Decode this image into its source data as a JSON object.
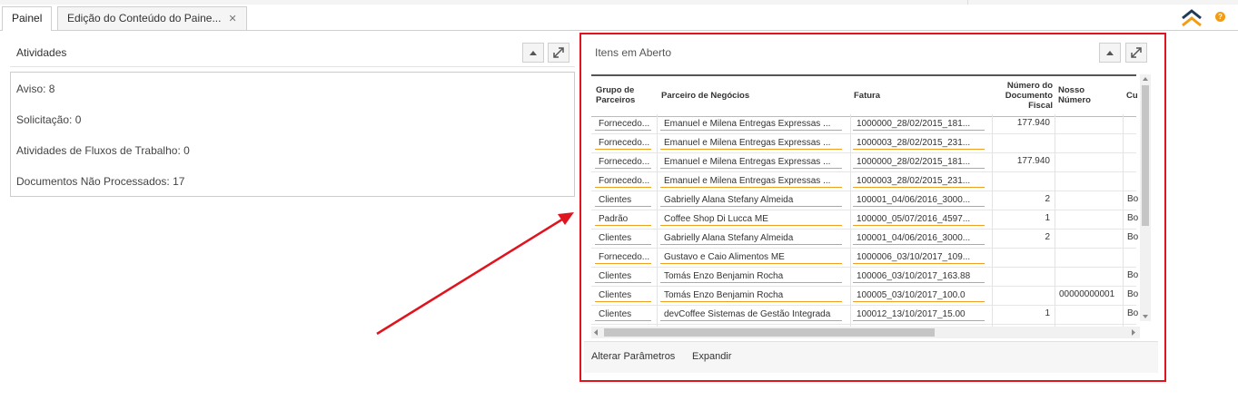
{
  "tabs": [
    {
      "label": "Painel",
      "active": true
    },
    {
      "label": "Edição do Conteúdo do Paine...",
      "active": false,
      "closable": true
    }
  ],
  "icons": {
    "tab_close": "✕",
    "help": "?",
    "collapse_up": "chevron-double-up-icon"
  },
  "colors": {
    "accent_orange": "#f39c12",
    "highlight_red": "#e0141e",
    "chevron_blue": "#1f3b5a"
  },
  "activities": {
    "title": "Atividades",
    "lines": [
      "Aviso: 8",
      "Solicitação: 0",
      "Atividades de Fluxos de Trabalho: 0",
      "Documentos Não Processados: 17"
    ]
  },
  "open_items": {
    "title": "Itens em Aberto",
    "columns": [
      "Grupo de Parceiros",
      "Parceiro de Negócios",
      "Fatura",
      "Número do Documento Fiscal",
      "Nosso Número",
      "Cu"
    ],
    "rows": [
      [
        "Fornecedo...",
        "Emanuel e Milena Entregas Expressas ...",
        "1000000_28/02/2015_181...",
        "177.940",
        "",
        ""
      ],
      [
        "Fornecedo...",
        "Emanuel e Milena Entregas Expressas ...",
        "1000003_28/02/2015_231...",
        "",
        "",
        ""
      ],
      [
        "Fornecedo...",
        "Emanuel e Milena Entregas Expressas ...",
        "1000000_28/02/2015_181...",
        "177.940",
        "",
        ""
      ],
      [
        "Fornecedo...",
        "Emanuel e Milena Entregas Expressas ...",
        "1000003_28/02/2015_231...",
        "",
        "",
        ""
      ],
      [
        "Clientes",
        "Gabrielly Alana Stefany Almeida",
        "100001_04/06/2016_3000...",
        "2",
        "",
        "Bo"
      ],
      [
        "Padrão",
        "Coffee Shop Di Lucca ME",
        "100000_05/07/2016_4597...",
        "1",
        "",
        "Bo"
      ],
      [
        "Clientes",
        "Gabrielly Alana Stefany Almeida",
        "100001_04/06/2016_3000...",
        "2",
        "",
        "Bo"
      ],
      [
        "Fornecedo...",
        "Gustavo e Caio Alimentos ME",
        "1000006_03/10/2017_109...",
        "",
        "",
        ""
      ],
      [
        "Clientes",
        "Tomás Enzo Benjamin Rocha",
        "100006_03/10/2017_163.88",
        "",
        "",
        "Bo"
      ],
      [
        "Clientes",
        "Tomás Enzo Benjamin Rocha",
        "100005_03/10/2017_100.0",
        "",
        "00000000001",
        "Bo"
      ],
      [
        "Clientes",
        "devCoffee Sistemas de Gestão Integrada",
        "100012_13/10/2017_15.00",
        "1",
        "",
        "Bo"
      ]
    ],
    "footer": {
      "change_params": "Alterar Parâmetros",
      "expand": "Expandir"
    }
  }
}
